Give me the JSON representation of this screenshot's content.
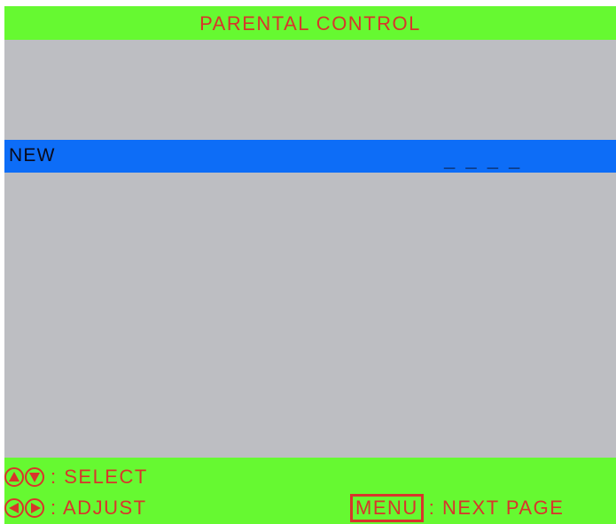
{
  "header": {
    "title": "PARENTAL CONTROL"
  },
  "row": {
    "label": "NEW",
    "code": "_ _ _ _"
  },
  "footer": {
    "select_icons": [
      "arrow-up-icon",
      "arrow-down-icon"
    ],
    "select_text": ": SELECT",
    "adjust_icons": [
      "arrow-left-icon",
      "arrow-right-icon"
    ],
    "adjust_text": ": ADJUST",
    "menu_key": "MENU",
    "menu_text": ": NEXT PAGE"
  },
  "colors": {
    "header_bg": "#66f931",
    "text_red": "#d8352b",
    "screen_bg": "#bdbec2",
    "highlight_bg": "#0d6df7"
  }
}
